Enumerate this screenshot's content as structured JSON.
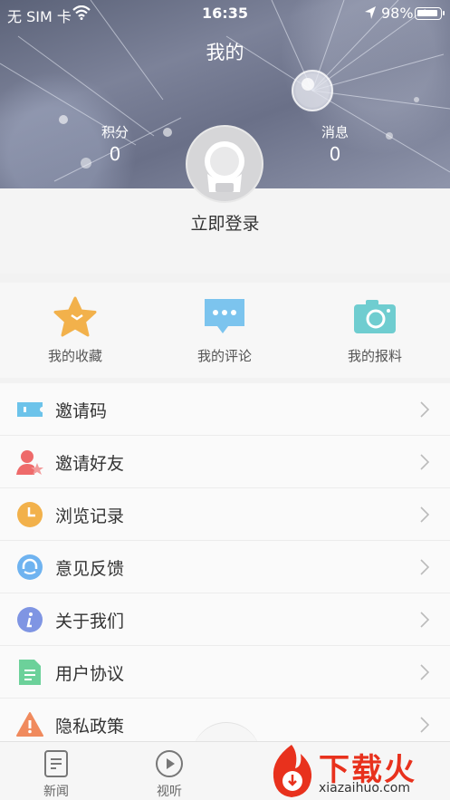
{
  "status_bar": {
    "carrier": "无 SIM 卡",
    "time": "16:35",
    "battery": "98%"
  },
  "header": {
    "title": "我的",
    "points_label": "积分",
    "points_value": "0",
    "messages_label": "消息",
    "messages_value": "0"
  },
  "login": {
    "label": "立即登录"
  },
  "quick_actions": [
    {
      "label": "我的收藏",
      "icon": "star-icon",
      "color": "#f2b14b"
    },
    {
      "label": "我的评论",
      "icon": "comment-icon",
      "color": "#7cc4ee"
    },
    {
      "label": "我的报料",
      "icon": "camera-icon",
      "color": "#6fcdd0"
    }
  ],
  "menu": [
    {
      "label": "邀请码",
      "icon": "ticket-icon",
      "color": "#6cc3ea"
    },
    {
      "label": "邀请好友",
      "icon": "user-star-icon",
      "color": "#ee6a6a"
    },
    {
      "label": "浏览记录",
      "icon": "clock-icon",
      "color": "#f2b14b"
    },
    {
      "label": "意见反馈",
      "icon": "headset-icon",
      "color": "#6fb3f0"
    },
    {
      "label": "关于我们",
      "icon": "info-icon",
      "color": "#7f95e3"
    },
    {
      "label": "用户协议",
      "icon": "document-icon",
      "color": "#6cd19a"
    },
    {
      "label": "隐私政策",
      "icon": "warning-icon",
      "color": "#f08a5d"
    }
  ],
  "tabbar": {
    "news_label": "新闻",
    "video_label": "视听"
  },
  "watermark": {
    "big": "下载火",
    "small": "xiazaihuo.com"
  }
}
